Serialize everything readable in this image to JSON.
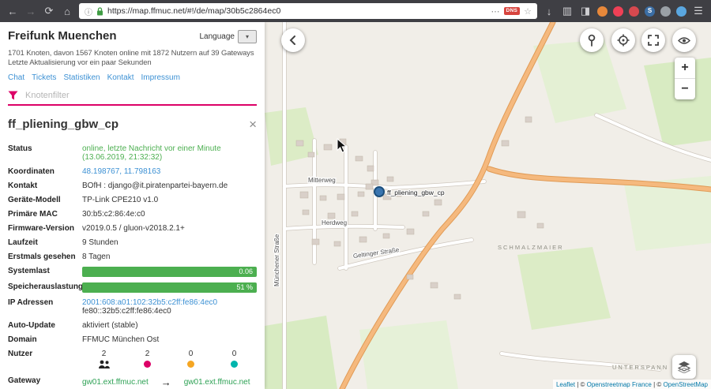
{
  "colors": {
    "accent": "#dc0067",
    "status_green": "#4caf50",
    "link_blue": "#3d91d4",
    "gateway_green": "#2da154",
    "client_pink": "#dc0067",
    "client_orange": "#f5a623",
    "client_teal": "#00b5ad",
    "marker_blue": "#3a75b0"
  },
  "browser": {
    "url": "https://map.ffmuc.net/#!/de/map/30b5c2864ec0",
    "dns_badge": "DNS",
    "glyphs": {
      "back": "←",
      "forward": "→",
      "reload": "⟳",
      "home": "⌂",
      "info": "ⓘ",
      "dots": "⋯",
      "star": "☆",
      "download": "↓",
      "library": "▥",
      "sidebar": "◨",
      "menu": "☰",
      "ext_s": "S"
    }
  },
  "sidebar": {
    "title": "Freifunk Muenchen",
    "language_label": "Language",
    "language_select": "▾",
    "stats_line1": "1701 Knoten, davon 1567 Knoten online mit 1872 Nutzern auf 39 Gateways",
    "stats_line2": "Letzte Aktualisierung vor ein paar Sekunden",
    "nav_links": [
      "Chat",
      "Tickets",
      "Statistiken",
      "Kontakt",
      "Impressum"
    ],
    "filter_placeholder": "Knotenfilter"
  },
  "node": {
    "title": "ff_pliening_gbw_cp",
    "close": "×",
    "rows": {
      "status": {
        "label": "Status",
        "value": "online, letzte Nachricht vor einer Minute (13.06.2019, 21:32:32)"
      },
      "koordinaten": {
        "label": "Koordinaten",
        "value": "48.198767, 11.798163"
      },
      "kontakt": {
        "label": "Kontakt",
        "value": "BOfH : django@it.piratenpartei-bayern.de"
      },
      "modell": {
        "label": "Geräte-Modell",
        "value": "TP-Link CPE210 v1.0"
      },
      "mac": {
        "label": "Primäre MAC",
        "value": "30:b5:c2:86:4e:c0"
      },
      "firmware": {
        "label": "Firmware-Version",
        "value": "v2019.0.5 / gluon-v2018.2.1+"
      },
      "laufzeit": {
        "label": "Laufzeit",
        "value": "9 Stunden"
      },
      "erstmals": {
        "label": "Erstmals gesehen",
        "value": "8 Tagen"
      },
      "systemlast": {
        "label": "Systemlast",
        "value": "0.06"
      },
      "speicher": {
        "label": "Speicherauslastung",
        "value": "51 %"
      },
      "ip": {
        "label": "IP Adressen",
        "link": "2001:608:a01:102:32b5:c2ff:fe86:4ec0",
        "plain": "fe80::32b5:c2ff:fe86:4ec0"
      },
      "autoupdate": {
        "label": "Auto-Update",
        "value": "aktiviert (stable)"
      },
      "domain": {
        "label": "Domain",
        "value": "FFMUC München Ost"
      },
      "nutzer": {
        "label": "Nutzer",
        "counts": [
          "2",
          "2",
          "0",
          "0"
        ]
      },
      "gateway": {
        "label": "Gateway",
        "hop": "gw01.ext.ffmuc.net",
        "arrow": "→",
        "target": "gw01.ext.ffmuc.net"
      }
    }
  },
  "map": {
    "node_label": "ff_pliening_gbw_cp",
    "streets": {
      "mitterweg": "Mitterweg",
      "herdweg": "Herdweg",
      "muenchener": "Münchener Straße",
      "geltinger": "Geltinger Straße",
      "schmalzmaier": "SCHMALZMAIER",
      "unterspann": "UNTERSPANN"
    },
    "zoom_in": "+",
    "zoom_out": "−",
    "attribution": {
      "leaflet": "Leaflet",
      "sep1": " | © ",
      "osmfr": "Openstreetmap France",
      "sep2": " | © ",
      "osm": "OpenStreetMap"
    }
  }
}
